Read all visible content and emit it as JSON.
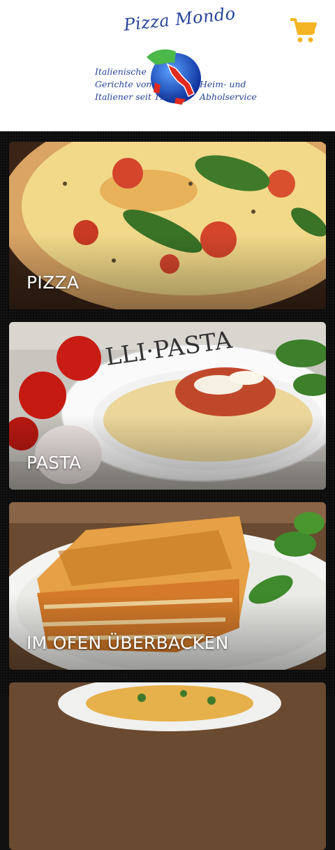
{
  "header": {
    "logo": {
      "brand": "Pizza Mondo",
      "tagline_left": [
        "Italienische",
        "Gerichte vom",
        "Italiener seit 1996"
      ],
      "tagline_right": [
        "Heim- und",
        "Abholservice"
      ]
    },
    "cart_icon": "shopping-cart-icon",
    "accent_color": "#f5b423"
  },
  "categories": [
    {
      "label": "PIZZA",
      "image": "pizza-margherita-photo"
    },
    {
      "label": "PASTA",
      "image": "tagliatelle-pasta-photo"
    },
    {
      "label": "IM OFEN ÜBERBACKEN",
      "image": "lasagne-photo"
    },
    {
      "image": "baked-dish-photo"
    }
  ]
}
